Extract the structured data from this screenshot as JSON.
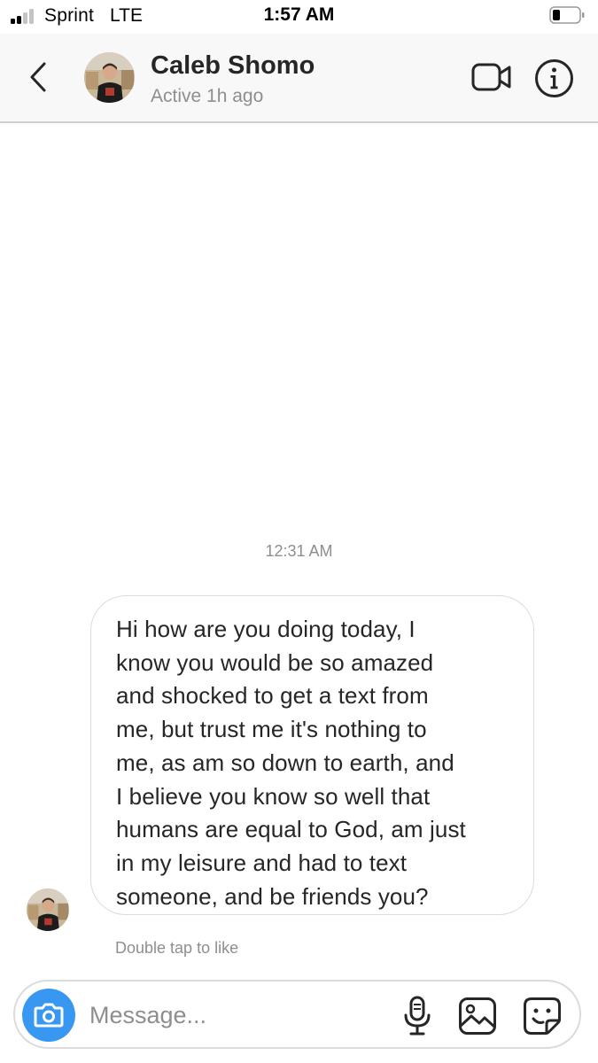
{
  "status_bar": {
    "carrier": "Sprint",
    "network": "LTE",
    "time": "1:57 AM",
    "signal_bars_active": 2,
    "signal_bars_total": 4,
    "battery_level": 0.25
  },
  "header": {
    "back_icon": "chevron-left-icon",
    "contact_name": "Caleb Shomo",
    "status": "Active 1h ago",
    "video_icon": "video-camera-icon",
    "info_icon": "info-icon"
  },
  "conversation": {
    "timestamp": "12:31 AM",
    "message_text": "Hi how are you doing today, I\nknow you would be so amazed\nand shocked to get a text from\nme, but trust me it's nothing to\nme, as am so down to earth, and\nI believe you know so well that\nhumans are equal to God, am just\nin my leisure and had to text\nsomeone, and be friends you?",
    "like_hint": "Double tap to like"
  },
  "composer": {
    "placeholder": "Message...",
    "value": "",
    "camera_icon": "camera-icon",
    "mic_icon": "microphone-icon",
    "gallery_icon": "image-icon",
    "sticker_icon": "sticker-icon"
  },
  "colors": {
    "accent": "#3897f0",
    "secondary_text": "#8e8e8e",
    "border": "#dbdbdb",
    "header_bg": "#f8f8f8"
  }
}
